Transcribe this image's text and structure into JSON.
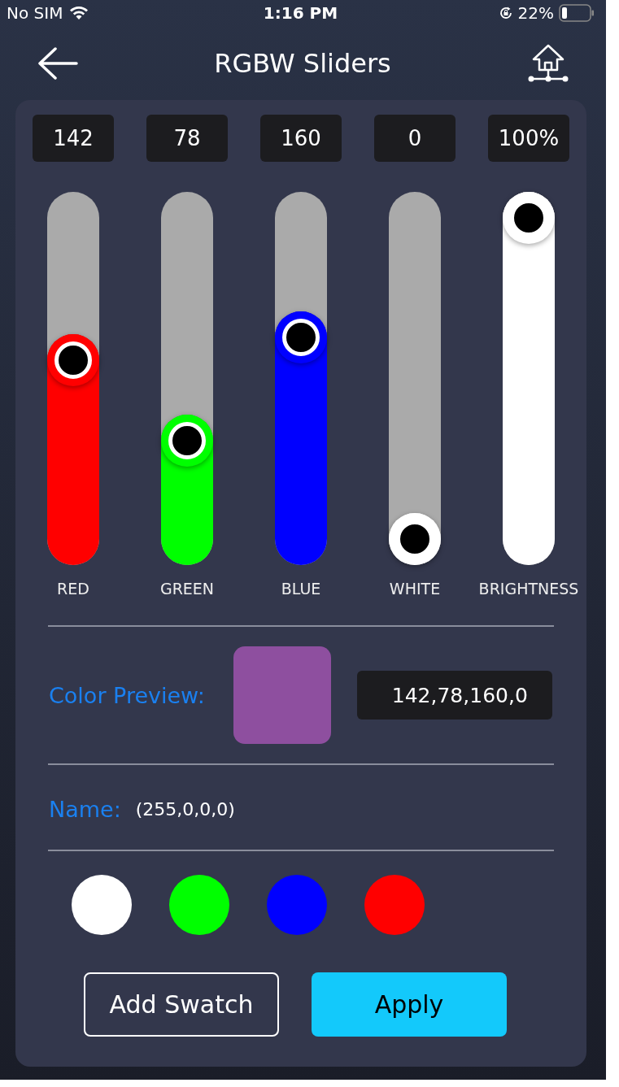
{
  "status_bar": {
    "carrier": "No SIM",
    "time": "1:16 PM",
    "battery": "22%"
  },
  "header": {
    "title": "RGBW Sliders"
  },
  "sliders": [
    {
      "label": "RED",
      "value": "142",
      "color": "#ff0000",
      "level": 0.557
    },
    {
      "label": "GREEN",
      "value": "78",
      "color": "#00ff00",
      "level": 0.306
    },
    {
      "label": "BLUE",
      "value": "160",
      "color": "#0000ff",
      "level": 0.627
    },
    {
      "label": "WHITE",
      "value": "0",
      "color": "#ffffff",
      "level": 0
    },
    {
      "label": "BRIGHTNESS",
      "value": "100%",
      "color": "#ffffff",
      "level": 1
    }
  ],
  "preview": {
    "label": "Color Preview:",
    "color": "#8e4f9f",
    "value": "142,78,160,0"
  },
  "name": {
    "label": "Name:",
    "value": "(255,0,0,0)"
  },
  "swatches": [
    {
      "color": "#ffffff"
    },
    {
      "color": "#00ff00"
    },
    {
      "color": "#0000ff"
    },
    {
      "color": "#ff0000"
    }
  ],
  "buttons": [
    {
      "label": "Add Swatch",
      "kind": "outline"
    },
    {
      "label": "Apply",
      "kind": "primary"
    }
  ]
}
